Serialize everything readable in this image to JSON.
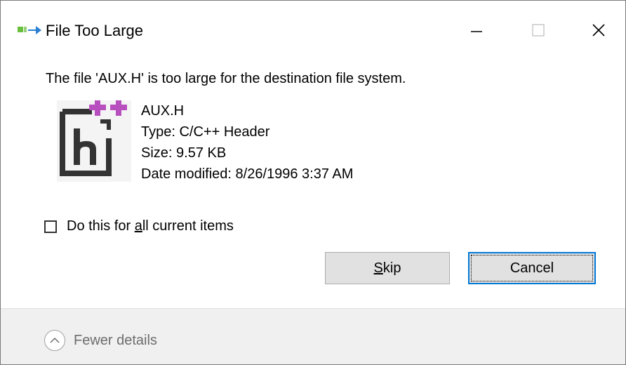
{
  "window": {
    "title": "File Too Large",
    "title_icon": "file-transfer-icon"
  },
  "message": "The file 'AUX.H' is too large for the destination file system.",
  "file": {
    "icon": "cpp-header-file-icon",
    "name": "AUX.H",
    "type": "Type: C/C++ Header",
    "size": "Size: 9.57 KB",
    "date_modified": "Date modified: 8/26/1996 3:37 AM"
  },
  "checkbox": {
    "label_before": "Do this for ",
    "label_mnemonic": "a",
    "label_after": "ll current items",
    "checked": false
  },
  "buttons": {
    "skip_mnemonic": "S",
    "skip_rest": "kip",
    "cancel": "Cancel"
  },
  "footer": {
    "details_label": "Fewer details"
  },
  "colors": {
    "accent": "#0078d7",
    "footer_bg": "#f0f0f0",
    "button_bg": "#e1e1e1",
    "icon_plus": "#b84fbf",
    "icon_dark": "#333333"
  }
}
